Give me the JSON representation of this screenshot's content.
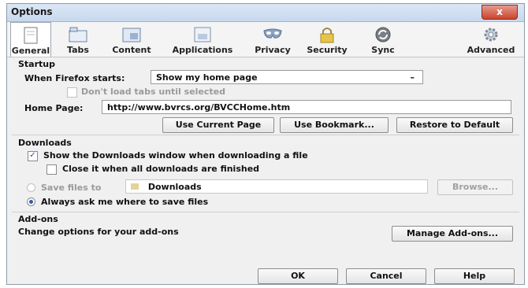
{
  "window": {
    "title": "Options",
    "close_glyph": "x"
  },
  "toolbar": {
    "tabs": [
      {
        "label": "General",
        "icon": "general-icon",
        "selected": true
      },
      {
        "label": "Tabs",
        "icon": "tabs-icon"
      },
      {
        "label": "Content",
        "icon": "content-icon"
      },
      {
        "label": "Applications",
        "icon": "applications-icon"
      },
      {
        "label": "Privacy",
        "icon": "privacy-mask-icon"
      },
      {
        "label": "Security",
        "icon": "padlock-icon"
      },
      {
        "label": "Sync",
        "icon": "sync-icon"
      },
      {
        "label": "Advanced",
        "icon": "gear-icon"
      }
    ]
  },
  "startup": {
    "heading": "Startup",
    "when_starts_label": "When Firefox starts:",
    "when_starts_value": "Show my home page",
    "dont_load_tabs": "Don't load tabs until selected",
    "home_page_label": "Home Page:",
    "home_page_value": "http://www.bvrcs.org/BVCCHome.htm",
    "use_current": "Use Current Page",
    "use_bookmark": "Use Bookmark...",
    "restore_default": "Restore to Default"
  },
  "downloads": {
    "heading": "Downloads",
    "show_window": "Show the Downloads window when downloading a file",
    "close_it": "Close it when all downloads are finished",
    "save_files_to": "Save files to",
    "folder": "Downloads",
    "browse": "Browse...",
    "always_ask": "Always ask me where to save files"
  },
  "addons": {
    "heading": "Add-ons",
    "description": "Change options for your add-ons",
    "manage": "Manage Add-ons..."
  },
  "footer": {
    "ok": "OK",
    "cancel": "Cancel",
    "help": "Help"
  },
  "colors": {
    "title_bar": "#c7d8ee",
    "close": "#c8452f",
    "radio_dot": "#2f5ea8"
  }
}
